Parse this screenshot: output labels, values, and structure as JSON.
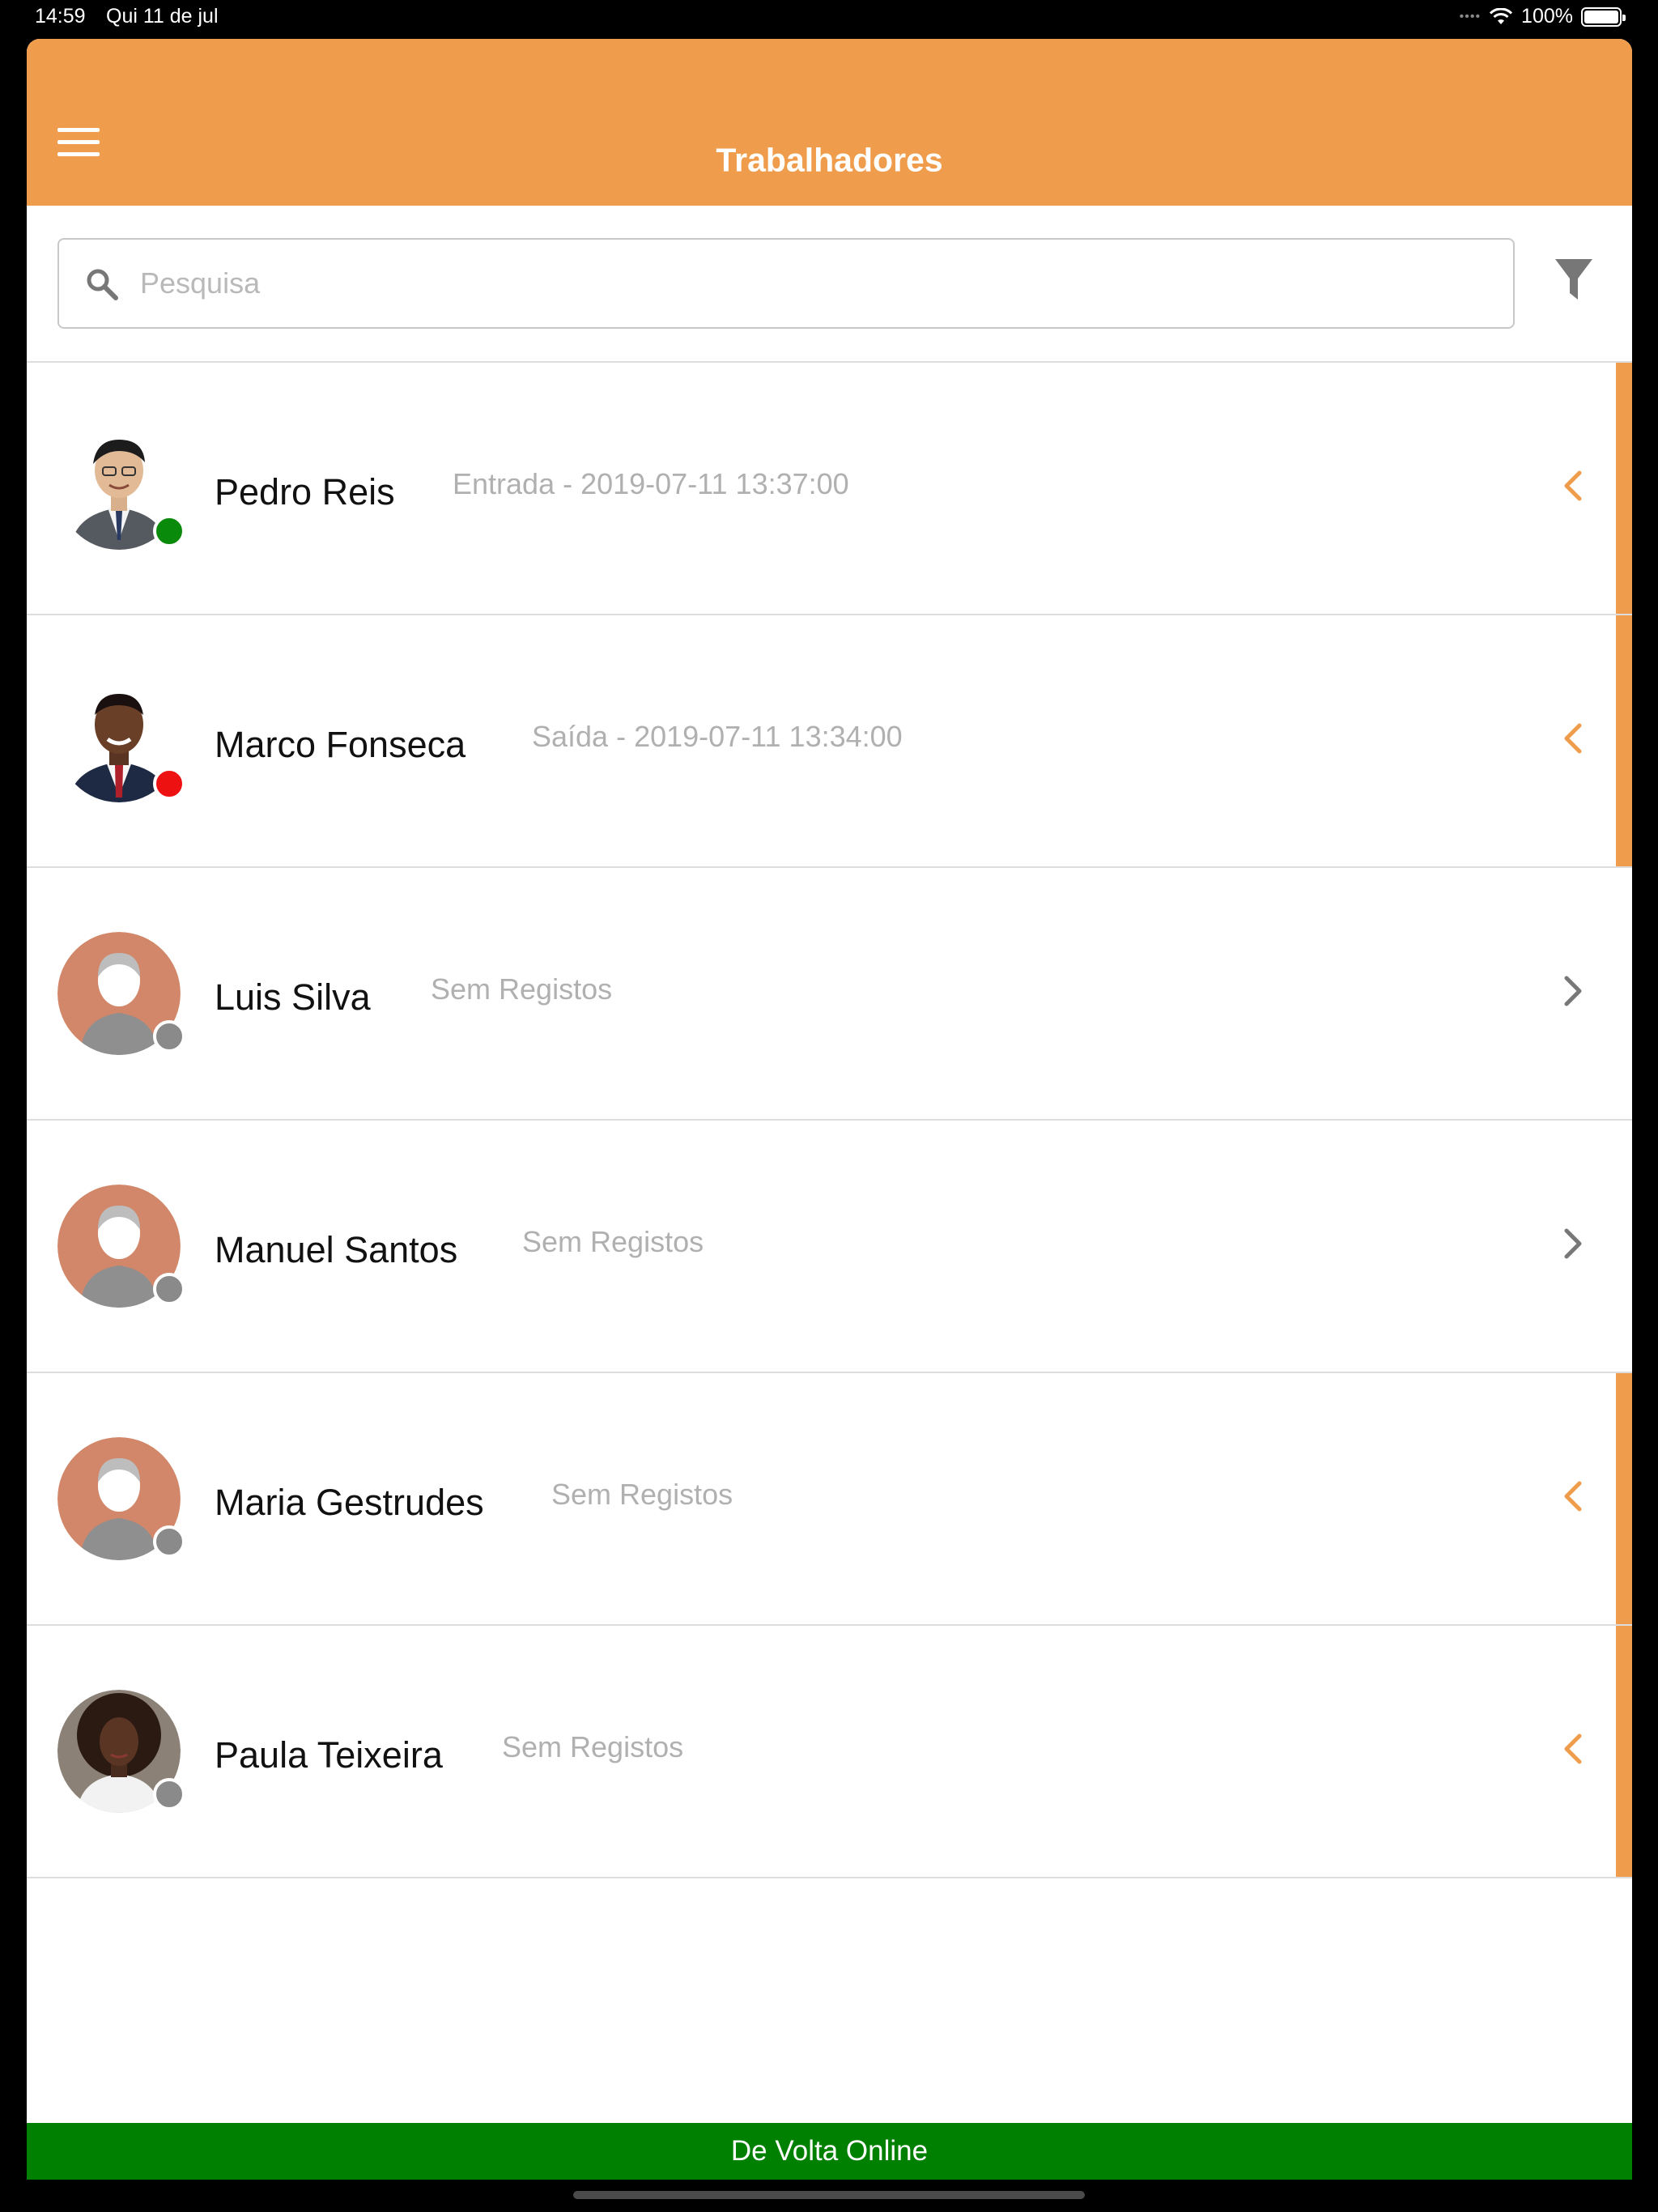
{
  "status_bar": {
    "time": "14:59",
    "date": "Qui 11 de jul",
    "battery": "100%"
  },
  "header": {
    "title": "Trabalhadores",
    "menu_icon": "hamburger-menu-icon",
    "background": "#EF9D4C"
  },
  "search": {
    "placeholder": "Pesquisa",
    "value": "",
    "icon": "search-icon",
    "filter_icon": "filter-funnel-icon"
  },
  "workers": [
    {
      "name": "Pedro Reis",
      "subtitle": "Entrada - 2019-07-11 13:37:00",
      "status": "green",
      "avatar": "photo",
      "expanded_indicator": true,
      "chevron": "chevron-left"
    },
    {
      "name": "Marco Fonseca",
      "subtitle": "Saída - 2019-07-11 13:34:00",
      "status": "red",
      "avatar": "photo",
      "expanded_indicator": true,
      "chevron": "chevron-left"
    },
    {
      "name": "Luis Silva",
      "subtitle": "Sem Registos",
      "status": "gray",
      "avatar": "placeholder",
      "expanded_indicator": false,
      "chevron": "chevron-right"
    },
    {
      "name": "Manuel Santos",
      "subtitle": "Sem Registos",
      "status": "gray",
      "avatar": "placeholder",
      "expanded_indicator": false,
      "chevron": "chevron-right"
    },
    {
      "name": "Maria Gestrudes",
      "subtitle": "Sem Registos",
      "status": "gray",
      "avatar": "placeholder",
      "expanded_indicator": true,
      "chevron": "chevron-left"
    },
    {
      "name": "Paula Teixeira",
      "subtitle": "Sem Registos",
      "status": "gray",
      "avatar": "photo",
      "expanded_indicator": true,
      "chevron": "chevron-left"
    }
  ],
  "footer_banner": {
    "text": "De Volta Online",
    "background": "#008000"
  },
  "colors": {
    "accent": "#EF9D4C",
    "status_green": "#0a8a0a",
    "status_red": "#ee1111",
    "status_gray": "#8a8a8a"
  }
}
